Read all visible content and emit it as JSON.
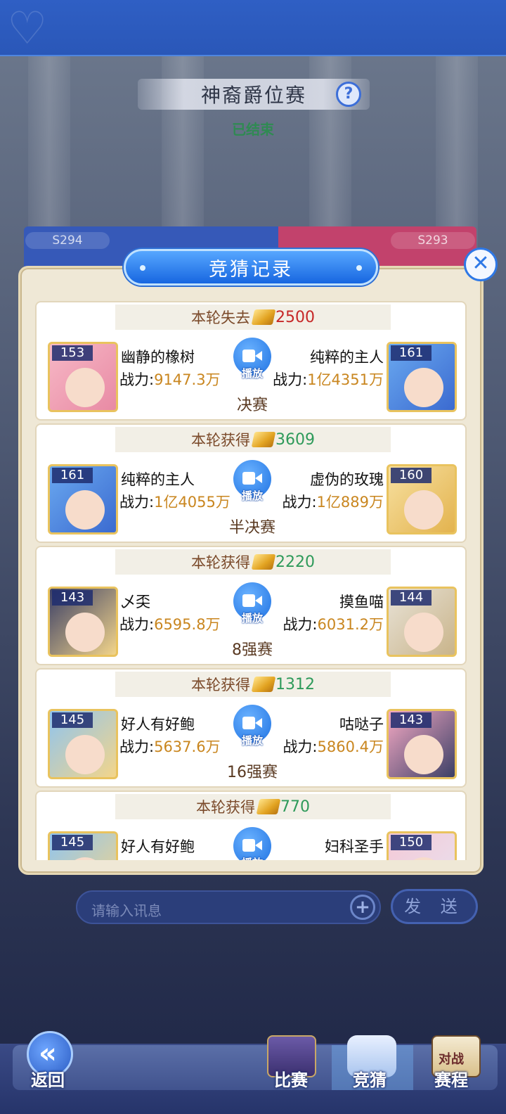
{
  "header": {
    "title": "神裔爵位赛",
    "status": "已结束"
  },
  "teams": {
    "left_season": "S294",
    "right_season": "S293"
  },
  "modal": {
    "title": "竞猜记录",
    "close_icon": "close-icon",
    "records": [
      {
        "result_label": "本轮失去",
        "amount": "2500",
        "result_type": "loss",
        "left": {
          "level": "153",
          "name": "幽静的橡树",
          "power_label": "战力:",
          "power": "9147.3万"
        },
        "right": {
          "level": "161",
          "name": "纯粹的主人",
          "power_label": "战力:",
          "power": "1亿4351万"
        },
        "play_label": "播放",
        "round": "决赛"
      },
      {
        "result_label": "本轮获得",
        "amount": "3609",
        "result_type": "gain",
        "left": {
          "level": "161",
          "name": "纯粹的主人",
          "power_label": "战力:",
          "power": "1亿4055万"
        },
        "right": {
          "level": "160",
          "name": "虚伪的玫瑰",
          "power_label": "战力:",
          "power": "1亿889万"
        },
        "play_label": "播放",
        "round": "半决赛"
      },
      {
        "result_label": "本轮获得",
        "amount": "2220",
        "result_type": "gain",
        "left": {
          "level": "143",
          "name": "乄奀",
          "power_label": "战力:",
          "power": "6595.8万"
        },
        "right": {
          "level": "144",
          "name": "摸鱼喵",
          "power_label": "战力:",
          "power": "6031.2万"
        },
        "play_label": "播放",
        "round": "8强赛"
      },
      {
        "result_label": "本轮获得",
        "amount": "1312",
        "result_type": "gain",
        "left": {
          "level": "145",
          "name": "好人有好鲍",
          "power_label": "战力:",
          "power": "5637.6万"
        },
        "right": {
          "level": "143",
          "name": "咕哒子",
          "power_label": "战力:",
          "power": "5860.4万"
        },
        "play_label": "播放",
        "round": "16强赛"
      },
      {
        "result_label": "本轮获得",
        "amount": "770",
        "result_type": "gain",
        "left": {
          "level": "145",
          "name": "好人有好鲍",
          "power_label": "",
          "power": ""
        },
        "right": {
          "level": "150",
          "name": "妇科圣手",
          "power_label": "",
          "power": ""
        },
        "play_label": "播放",
        "round": ""
      }
    ]
  },
  "chat": {
    "placeholder": "请输入讯息",
    "send_label": "发 送"
  },
  "nav": {
    "back_label": "返回",
    "match_label": "比赛",
    "guess_label": "竞猜",
    "schedule_label": "赛程",
    "schedule_icon_text": "对战"
  },
  "colors": {
    "loss": "#c62727",
    "gain": "#2e9a5a",
    "power_value": "#c9861f",
    "accent_blue": "#1f72e2"
  }
}
